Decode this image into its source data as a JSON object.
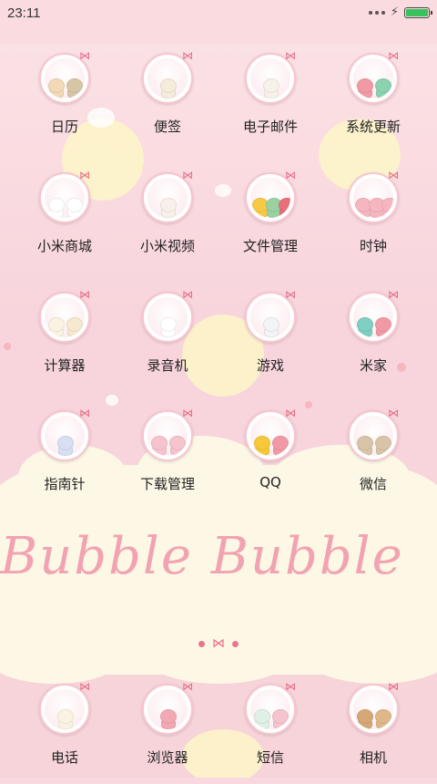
{
  "status_bar": {
    "time": "23:11",
    "battery_level": 1.0
  },
  "wallpaper": {
    "text": "Bubble Bubble"
  },
  "apps": [
    {
      "label": "日历",
      "plush": [
        "#f3d9b5",
        "#d7c6a6"
      ]
    },
    {
      "label": "便签",
      "plush": [
        "#f6ecdc"
      ]
    },
    {
      "label": "电子邮件",
      "plush": [
        "#f8f1ea"
      ]
    },
    {
      "label": "系统更新",
      "plush": [
        "#f19aa5",
        "#8ad2b0"
      ]
    },
    {
      "label": "小米商城",
      "plush": [
        "#ffffff",
        "#ffffff"
      ]
    },
    {
      "label": "小米视频",
      "plush": [
        "#f8f1ea"
      ]
    },
    {
      "label": "文件管理",
      "plush": [
        "#f7c945",
        "#9ad1a2",
        "#e96f7a"
      ]
    },
    {
      "label": "时钟",
      "plush": [
        "#f6b6c0",
        "#f6b6c0",
        "#f6b6c0"
      ]
    },
    {
      "label": "计算器",
      "plush": [
        "#fbf3e2",
        "#f6e9cf"
      ]
    },
    {
      "label": "录音机",
      "plush": [
        "#ffffff"
      ]
    },
    {
      "label": "游戏",
      "plush": [
        "#f2f4f6"
      ]
    },
    {
      "label": "米家",
      "plush": [
        "#7fcfc2",
        "#f19aa5"
      ]
    },
    {
      "label": "指南针",
      "plush": [
        "#d6e0f2"
      ]
    },
    {
      "label": "下载管理",
      "plush": [
        "#f6c4cc",
        "#f6c4cc"
      ]
    },
    {
      "label": "QQ",
      "plush": [
        "#f7c83a",
        "#f19aa5"
      ]
    },
    {
      "label": "微信",
      "plush": [
        "#d9c4a8",
        "#d9c4a8"
      ]
    }
  ],
  "dock": [
    {
      "label": "电话",
      "plush": [
        "#fbf3e2"
      ]
    },
    {
      "label": "浏览器",
      "plush": [
        "#f3a9b3"
      ]
    },
    {
      "label": "短信",
      "plush": [
        "#dff0e7",
        "#f6c4cc"
      ]
    },
    {
      "label": "相机",
      "plush": [
        "#d6a876",
        "#e0b888"
      ]
    }
  ],
  "colors": {
    "accent": "#e8758f",
    "label": "#222222",
    "battery": "#38c25c"
  }
}
